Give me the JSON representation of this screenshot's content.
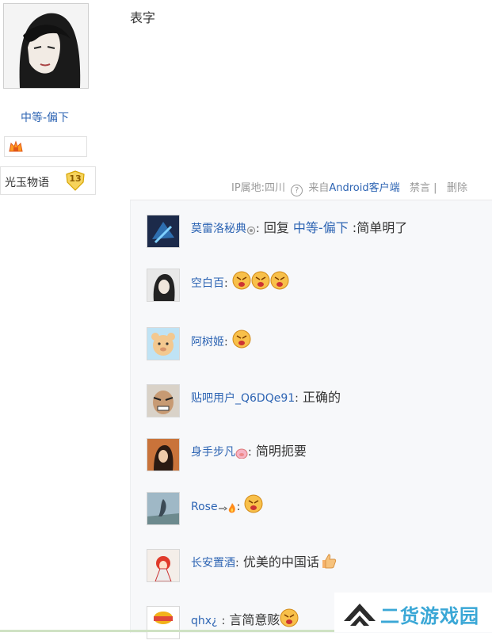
{
  "author": {
    "name": "中等-偏下",
    "forum_label": "光玉物语",
    "level": "13"
  },
  "post": {
    "text": "表字",
    "meta": {
      "ip": "IP属地:四川",
      "source_prefix": "来自",
      "source": "Android客户端",
      "ban": "禁言 |",
      "delete": "删除"
    }
  },
  "comments": [
    {
      "user": "莫雷洛秘典",
      "sep": ":",
      "prefix": "回复",
      "reply_to": "中等-偏下",
      "text": ":简单明了"
    },
    {
      "user": "空白百",
      "sep": ":",
      "text": ""
    },
    {
      "user": "阿树姬",
      "sep": ":",
      "text": ""
    },
    {
      "user": "贴吧用户_Q6DQe91",
      "sep": ":",
      "text": "正确的"
    },
    {
      "user": "身手步凡",
      "sep": ":",
      "text": "简明扼要"
    },
    {
      "user": "Rose",
      "sep": ":",
      "text": ""
    },
    {
      "user": "长安置酒",
      "sep": ":",
      "text": "优美的中国话"
    },
    {
      "user": "qhx¿",
      "sep": ":",
      "text": "言简意赅"
    }
  ],
  "watermark": {
    "text": "二货游戏园"
  },
  "colors": {
    "link": "#2d64b3",
    "meta": "#999999",
    "panel": "#f7f8fa",
    "watermark": "#3aa7d6"
  }
}
